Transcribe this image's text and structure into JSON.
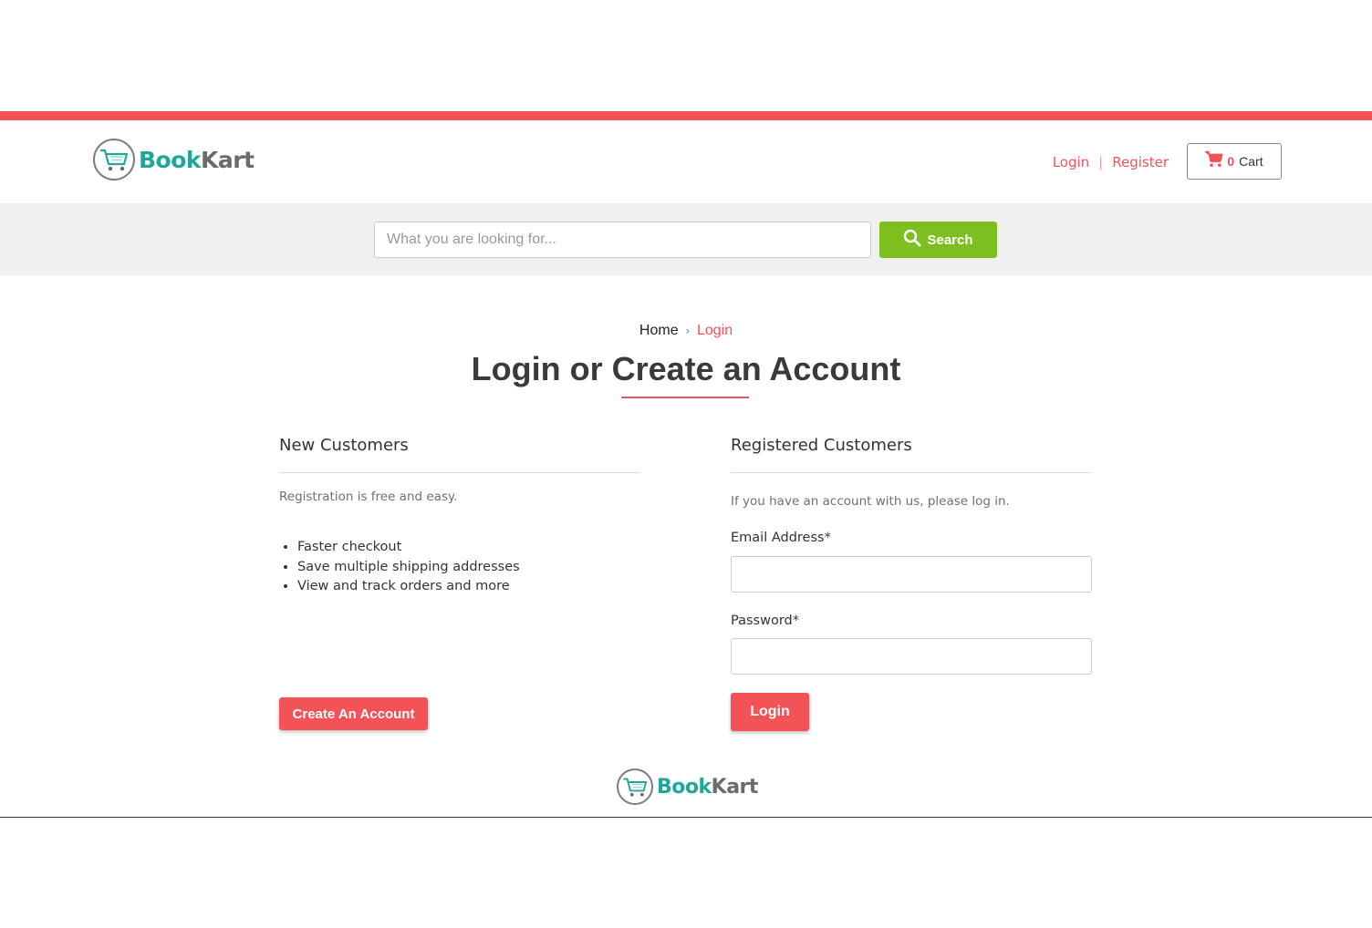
{
  "brand": {
    "name_part1": "Book",
    "name_part2": "Kart"
  },
  "header": {
    "login_label": "Login",
    "separator": "|",
    "register_label": "Register",
    "cart_count": "0",
    "cart_label": "Cart"
  },
  "search": {
    "placeholder": "What you are looking for...",
    "button_label": "Search"
  },
  "breadcrumb": {
    "home": "Home",
    "chevron": "›",
    "current": "Login"
  },
  "page_title": "Login or Create an Account",
  "new_customers": {
    "heading": "New Customers",
    "intro": "Registration is free and easy.",
    "benefits": [
      "Faster checkout",
      "Save multiple shipping addresses",
      "View and track orders and more"
    ],
    "button_label": "Create An Account"
  },
  "registered_customers": {
    "heading": "Registered Customers",
    "intro": "If you have an account with us, please log in.",
    "email_label": "Email Address*",
    "email_value": "",
    "password_label": "Password*",
    "password_value": "",
    "button_label": "Login"
  },
  "colors": {
    "accent": "#f35257",
    "search_button": "#7cbf1e",
    "brand_teal": "#1fa89a",
    "brand_gray": "#6b6b6b"
  },
  "icons": {
    "logo": "shopping-cart-logo-icon",
    "cart": "shopping-cart-icon",
    "search": "magnifier-icon"
  }
}
